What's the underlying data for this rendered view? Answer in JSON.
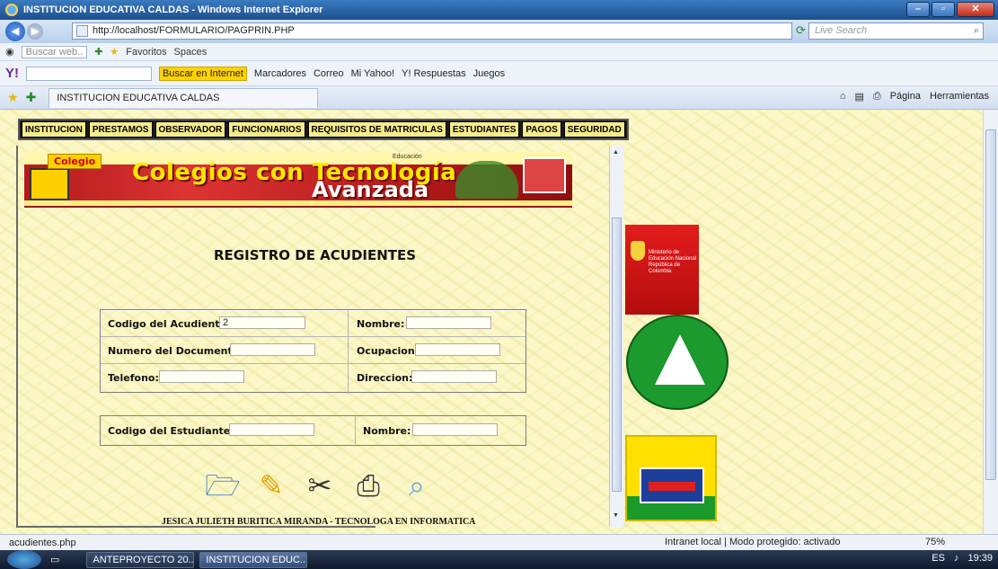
{
  "window": {
    "title": "INSTITUCION EDUCATIVA CALDAS - Windows Internet Explorer",
    "url": "http://localhost/FORMULARIO/PAGPRIN.PHP",
    "live_search_placeholder": "Live Search"
  },
  "toolbar1": {
    "search_box": "Buscar web..",
    "favoritos": "Favoritos",
    "spaces": "Spaces"
  },
  "toolbar2": {
    "buscar": "Buscar en Internet",
    "marcadores": "Marcadores",
    "correo": "Correo",
    "mi_yahoo": "Mi Yahoo!",
    "respuestas": "Y! Respuestas",
    "juegos": "Juegos"
  },
  "tab": {
    "label": "INSTITUCION EDUCATIVA CALDAS",
    "pagina": "Página",
    "herramientas": "Herramientas"
  },
  "menu": [
    "INSTITUCION",
    "PRESTAMOS",
    "OBSERVADOR",
    "FUNCIONARIOS",
    "REQUISITOS DE MATRICULAS",
    "ESTUDIANTES",
    "PAGOS",
    "SEGURIDAD"
  ],
  "banner": {
    "tag": "Colegio",
    "line1": "Colegios con Tecnología",
    "line2": "Avanzada",
    "edu": "Educación"
  },
  "form": {
    "title": "REGISTRO DE ACUDIENTES",
    "codigo_acudiente_label": "Codigo del Acudiente:",
    "codigo_acudiente_value": "2",
    "nombre_label": "Nombre:",
    "numero_documento_label": "Numero del Documento:",
    "ocupacion_label": "Ocupacion:",
    "telefono_label": "Telefono:",
    "direccion_label": "Direccion:",
    "codigo_estudiante_label": "Codigo del Estudiantes:",
    "nombre2_label": "Nombre:"
  },
  "footer": "JESICA JULIETH BURITICA MIRANDA - TECNOLOGA EN INFORMATICA",
  "logos": {
    "ministerio": "Ministerio de Educación Nacional República de Colombia"
  },
  "statusbar": {
    "left": "acudientes.php",
    "zone": "Intranet local | Modo protegido: activado",
    "zoom": "75%"
  },
  "taskbar": {
    "task1": "ANTEPROYECTO 20...",
    "task2": "INSTITUCION EDUC...",
    "lang": "ES",
    "time": "19:39"
  }
}
